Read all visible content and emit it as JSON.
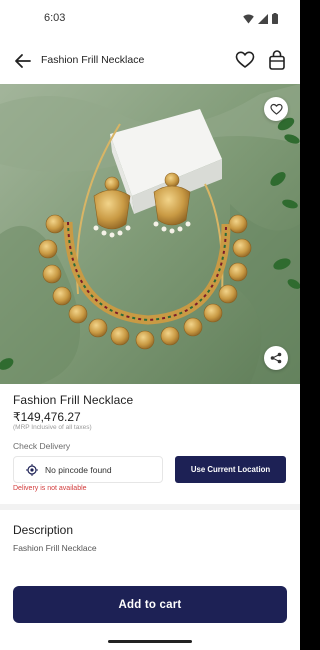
{
  "status_bar": {
    "time": "6:03",
    "icons": [
      "wifi-icon",
      "signal-icon",
      "battery-icon"
    ]
  },
  "app_bar": {
    "title": "Fashion Frill Necklace",
    "icons": [
      "back-arrow-icon",
      "heart-icon",
      "shopping-bag-icon"
    ]
  },
  "hero": {
    "image": "gold necklace and jhumka earrings on green cloth",
    "actions": [
      "heart-icon",
      "share-icon"
    ]
  },
  "product": {
    "name": "Fashion Frill Necklace",
    "price": "₹149,476.27",
    "tax_note": "(MRP Inclusive of all taxes)"
  },
  "delivery": {
    "label": "Check Delivery",
    "pincode_text": "No pincode found",
    "location_button": "Use Current Location",
    "error": "Delivery is not available"
  },
  "description": {
    "title": "Description",
    "text": "Fashion Frill Necklace"
  },
  "cta": {
    "add_to_cart": "Add to cart"
  },
  "colors": {
    "primary": "#1d2155",
    "error": "#d23b3b",
    "background_cloth": "#7d9a72"
  }
}
